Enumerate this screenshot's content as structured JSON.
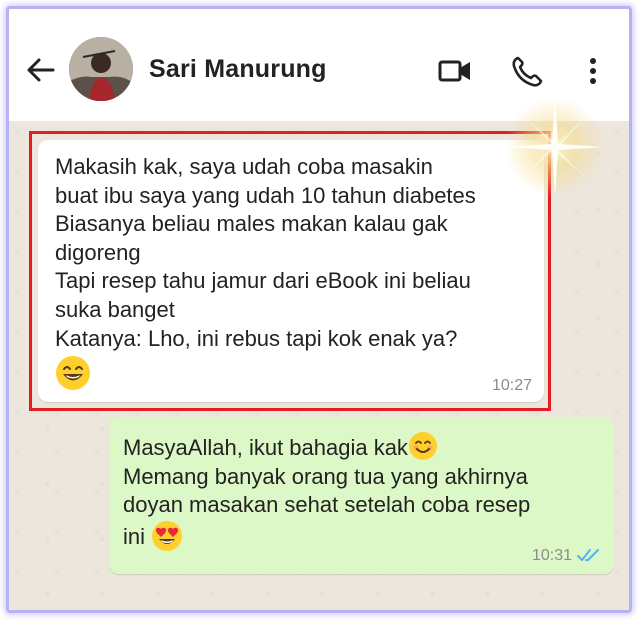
{
  "header": {
    "contact_name": "Sari Manurung",
    "icons": [
      "back-arrow-icon",
      "avatar",
      "video-call-icon",
      "phone-icon",
      "more-options-icon"
    ]
  },
  "messages": [
    {
      "direction": "incoming",
      "lines": [
        "Makasih kak, saya udah coba masakin",
        "buat ibu saya yang udah 10 tahun diabetes",
        "Biasanya beliau males makan kalau gak",
        "digoreng",
        "Tapi resep tahu jamur dari eBook ini beliau",
        "suka banget",
        "Katanya: Lho, ini rebus tapi kok enak ya?"
      ],
      "emoji": "smiling-face-icon",
      "time": "10:27",
      "highlighted": true
    },
    {
      "direction": "outgoing",
      "lines": [
        "MasyaAllah, ikut bahagia kak",
        "Memang banyak orang tua yang akhirnya",
        "doyan masakan sehat setelah coba resep",
        "ini"
      ],
      "emojis": [
        "smiling-face-icon",
        "heart-eyes-icon"
      ],
      "time": "10:31",
      "status": "read-double-check-icon"
    }
  ],
  "colors": {
    "incoming_bubble": "#ffffff",
    "outgoing_bubble": "#dcf8c6",
    "highlight_border": "#e02020",
    "read_check": "#4fb5ec",
    "chat_background": "#ece6dd"
  }
}
